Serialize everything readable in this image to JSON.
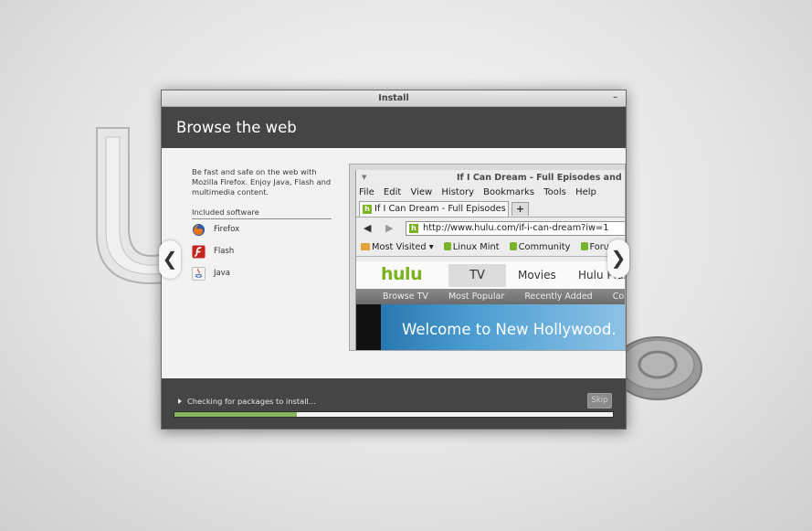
{
  "window": {
    "title": "Install",
    "close_icon": "minimize-icon"
  },
  "slide": {
    "heading": "Browse the web",
    "description": "Be fast and safe on the web with Mozilla Firefox. Enjoy Java, Flash and multimedia content.",
    "included_title": "Included software",
    "software": [
      {
        "label": "Firefox",
        "icon": "firefox-icon"
      },
      {
        "label": "Flash",
        "icon": "flash-icon"
      },
      {
        "label": "Java",
        "icon": "java-icon"
      }
    ],
    "prev_arrow": "❮",
    "next_arrow": "❯"
  },
  "browser_screenshot": {
    "title": "If I Can Dream - Full Episodes and C",
    "menu": [
      "File",
      "Edit",
      "View",
      "History",
      "Bookmarks",
      "Tools",
      "Help"
    ],
    "menu_accel": [
      "F",
      "E",
      "V",
      "s",
      "B",
      "T",
      "H"
    ],
    "tab_label": "If I Can Dream - Full Episodes a...",
    "new_tab": "+",
    "url": "http://www.hulu.com/if-i-can-dream?iw=1",
    "bookmarks": [
      "Most Visited ▾",
      "Linux Mint",
      "Community",
      "Forums"
    ],
    "hulu": {
      "logo": "hulu",
      "tabs": [
        "TV",
        "Movies",
        "Hulu Plus"
      ],
      "subnav": [
        "Browse TV",
        "Most Popular",
        "Recently Added",
        "Coming"
      ],
      "banner": "Welcome to New Hollywood."
    }
  },
  "footer": {
    "status": "Checking for packages to install...",
    "skip_label": "Skip",
    "progress_fraction": 0.28,
    "progress_color": "#86b35c"
  }
}
